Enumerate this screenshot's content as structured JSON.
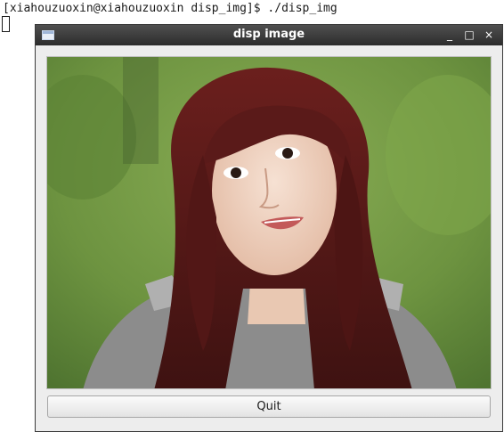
{
  "terminal": {
    "prompt_line": "[xiahouzuoxin@xiahouzuoxin disp_img]$ ./disp_img"
  },
  "window": {
    "title": "disp image",
    "controls": {
      "minimize": "_",
      "maximize": "□",
      "close": "×"
    },
    "quit_label": "Quit"
  },
  "colors": {
    "titlebar": "#3a3a3a",
    "window_bg": "#ededed",
    "photo_bg": "#6f9440"
  },
  "icons": [
    "window-icon",
    "minimize-icon",
    "maximize-icon",
    "close-icon"
  ]
}
